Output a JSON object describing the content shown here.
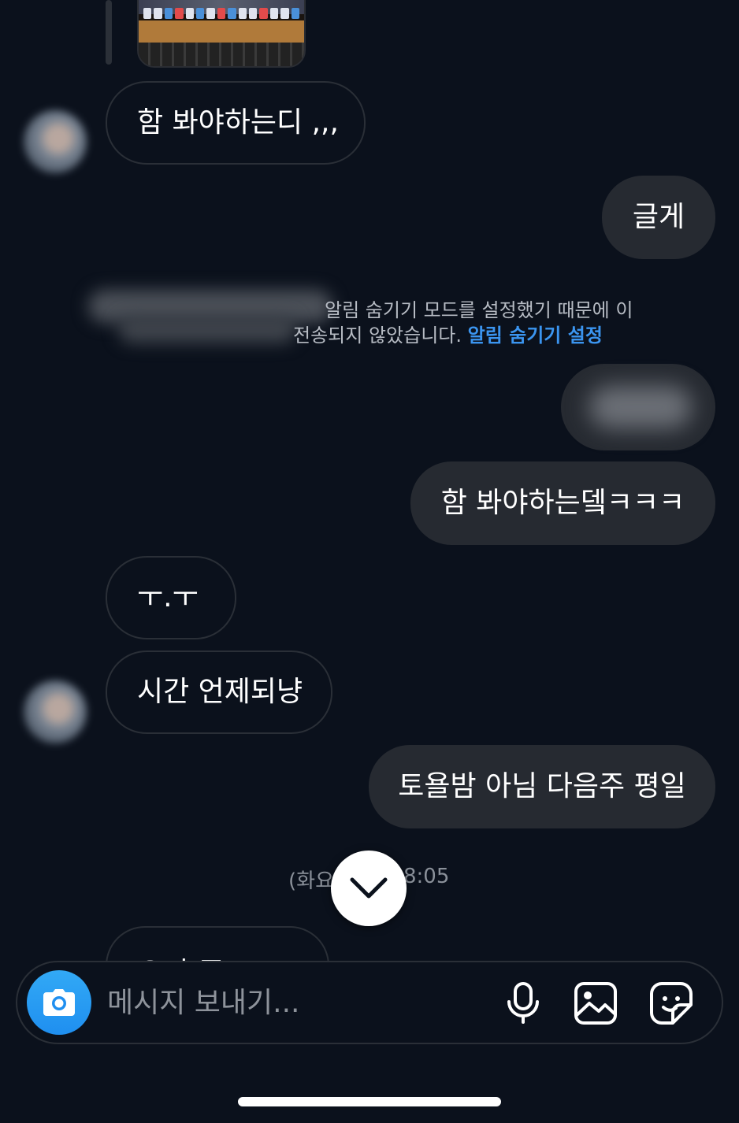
{
  "colors": {
    "background": "#0b111c",
    "outgoing_bubble": "#262a31",
    "incoming_border": "#2a2f37",
    "link": "#3b95f0",
    "camera_button": "#1f8ff0"
  },
  "messages": [
    {
      "direction": "in",
      "text": "함 봐야하는디 ,,,"
    },
    {
      "direction": "out",
      "text": "글게"
    },
    {
      "direction": "out",
      "text": "함 봐야하는뎈ㅋㅋㅋ"
    },
    {
      "direction": "in",
      "text": "ㅜ.ㅜ"
    },
    {
      "direction": "in",
      "text": "시간 언제되냥"
    },
    {
      "direction": "out",
      "text": "토욜밤 아님 다음주 평일"
    }
  ],
  "notice": {
    "line1": "알림 숨기기 모드를 설정했기 때문에 이",
    "line2": "전송되지 않았습니다.",
    "link": "알림 숨기기 설정"
  },
  "timestamp": {
    "left": "(화요",
    "right": "8:05"
  },
  "partial_message": "오빠 주 ㅇ?ㅇ?ㅇ?",
  "composer": {
    "placeholder": "메시지 보내기..."
  },
  "icons": {
    "scroll_down": "chevron-down-icon",
    "camera": "camera-icon",
    "mic": "microphone-icon",
    "gallery": "image-icon",
    "sticker": "sticker-icon"
  }
}
